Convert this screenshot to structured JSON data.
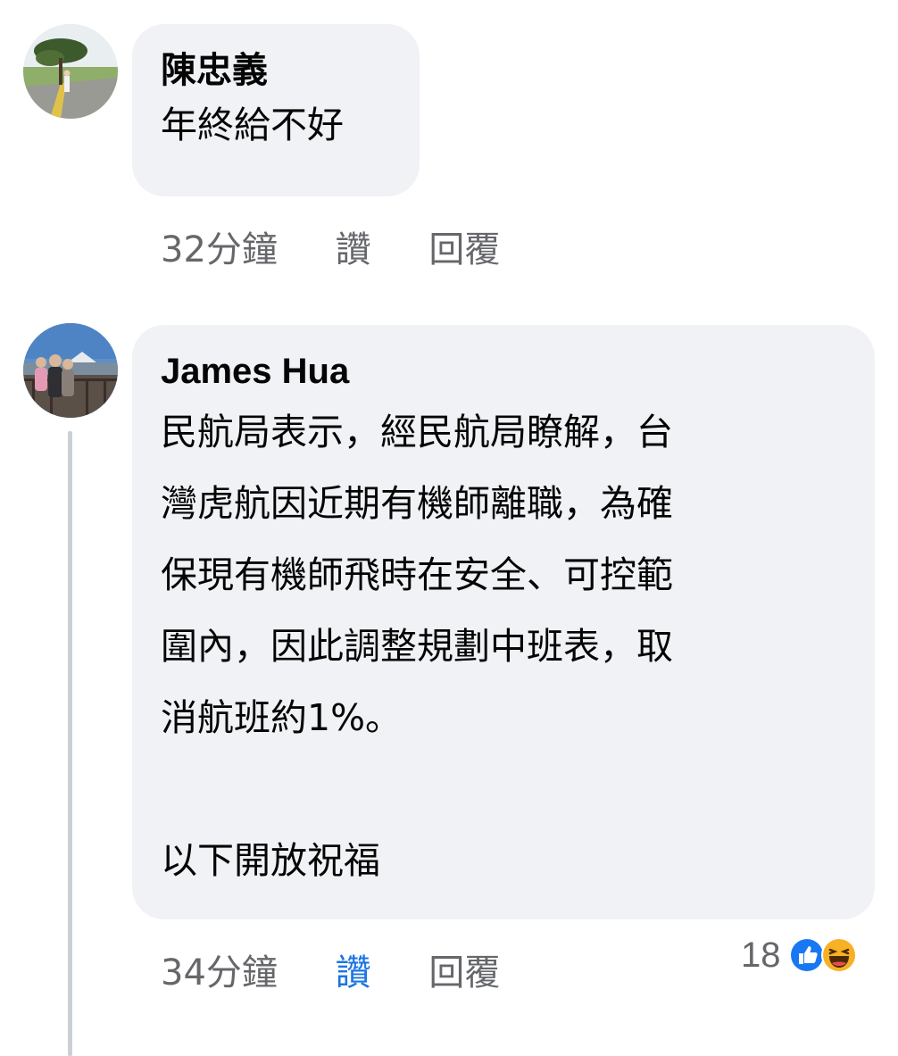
{
  "comments": [
    {
      "author": "陳忠義",
      "text_lines": [
        "年終給不好"
      ],
      "time": "32分鐘",
      "like_label": "讚",
      "reply_label": "回覆",
      "liked": false
    },
    {
      "author": "James Hua",
      "text_lines": [
        "民航局表示，經民航局瞭解，台",
        "灣虎航因近期有機師離職，為確",
        "保現有機師飛時在安全、可控範",
        "圍內，因此調整規劃中班表，取",
        "消航班約1%。",
        "",
        "以下開放祝福"
      ],
      "time": "34分鐘",
      "like_label": "讚",
      "reply_label": "回覆",
      "liked": true,
      "reactions": {
        "count": "18",
        "icons": [
          "like-reaction-icon",
          "haha-reaction-icon"
        ]
      }
    }
  ],
  "colors": {
    "bubble": "#f0f2f5",
    "meta_text": "#65676b",
    "like_active": "#1b74e4",
    "thread_line": "#ccd0d5"
  }
}
